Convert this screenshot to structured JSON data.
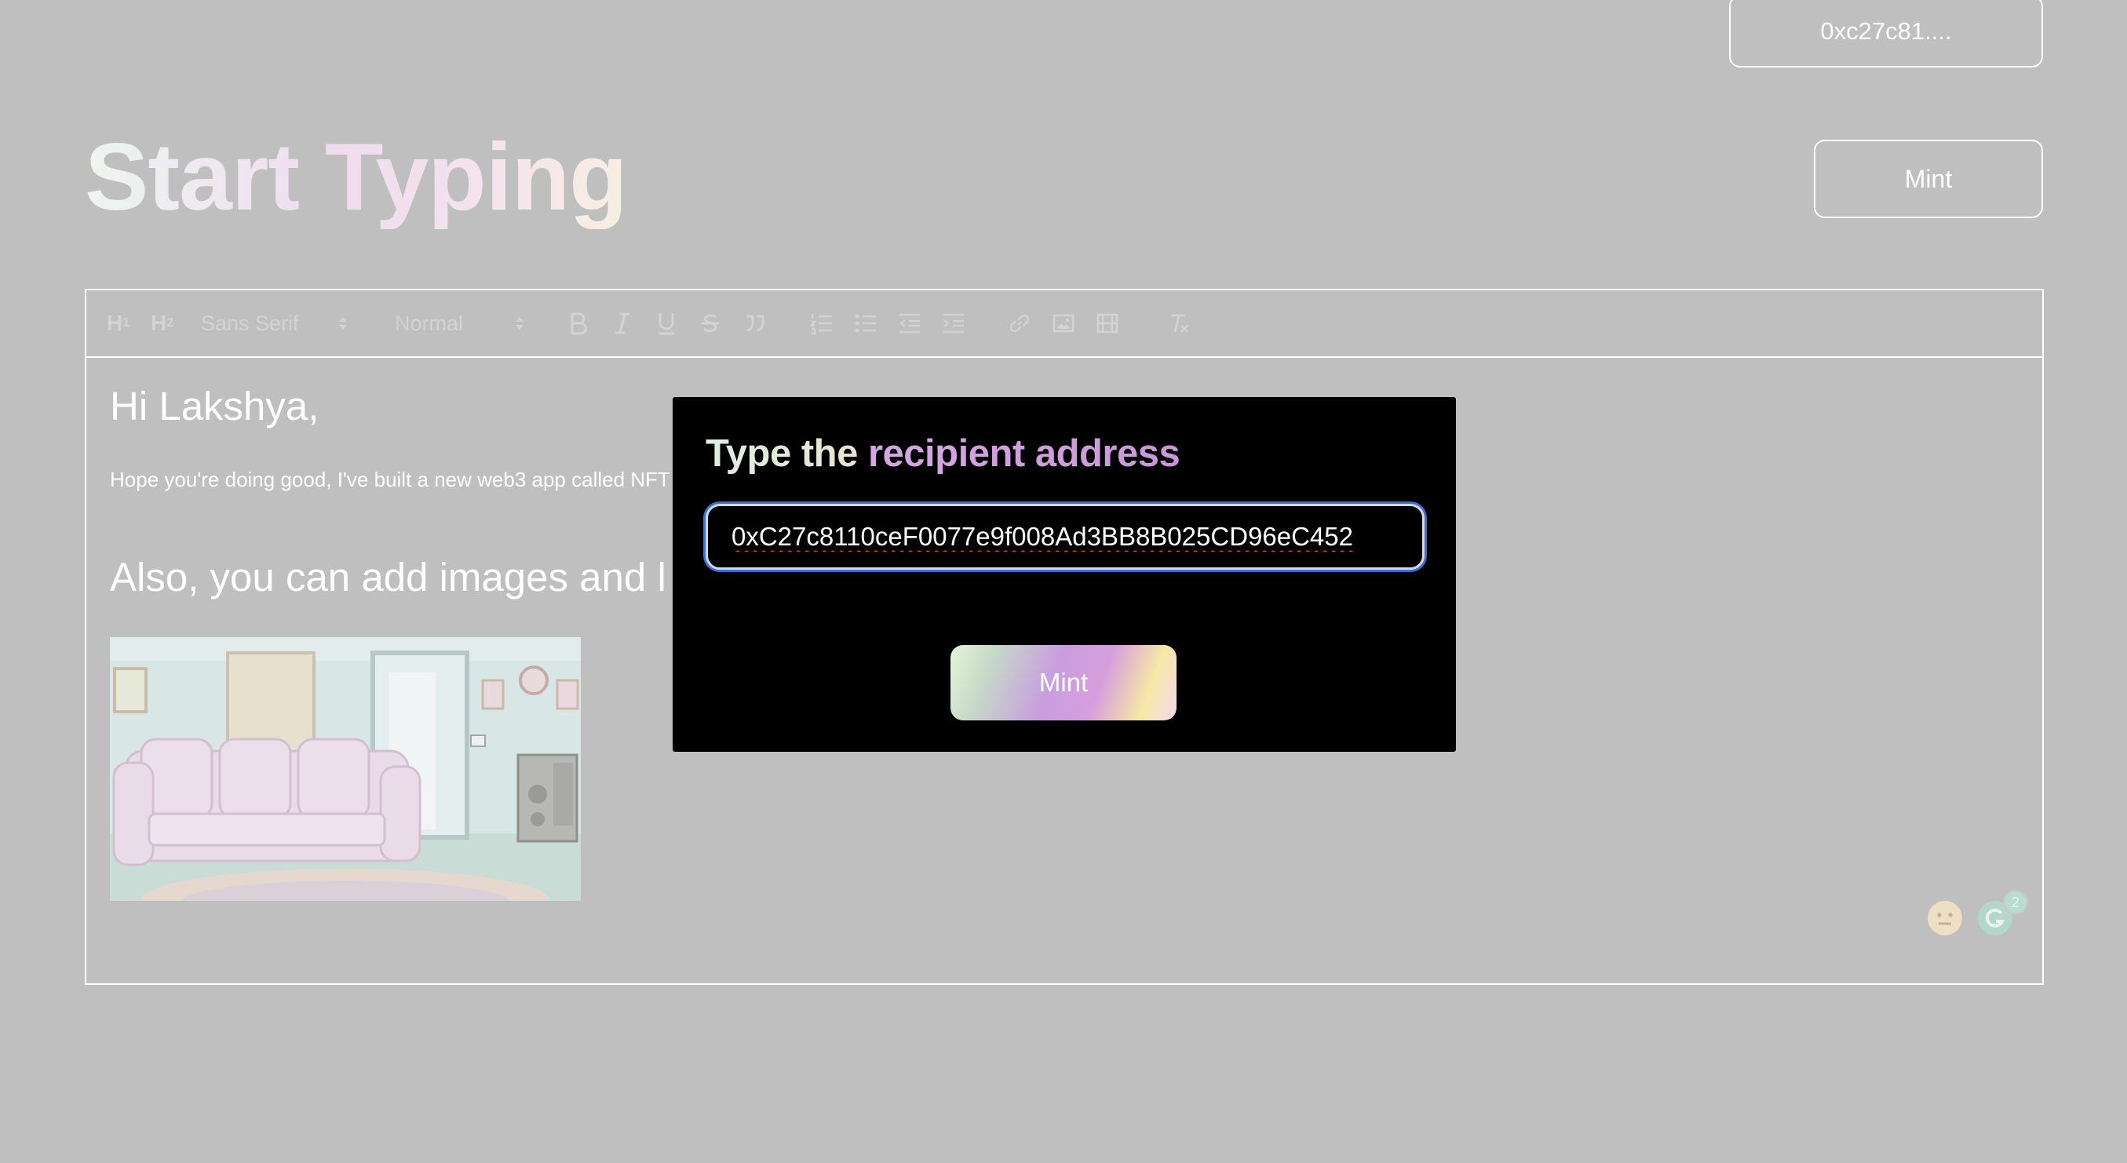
{
  "header": {
    "wallet_label": "0xc27c81....",
    "mint_label": "Mint",
    "title": "Start Typing"
  },
  "toolbar": {
    "heading1": "H",
    "heading1_sub": "1",
    "heading2": "H",
    "heading2_sub": "2",
    "font_select": "Sans Serif",
    "size_select": "Normal",
    "icons": [
      "bold-icon",
      "italic-icon",
      "underline-icon",
      "strike-icon",
      "quote-icon",
      "ordered-list-icon",
      "bullet-list-icon",
      "outdent-icon",
      "indent-icon",
      "link-icon",
      "image-icon",
      "video-icon",
      "clear-format-icon"
    ]
  },
  "editor": {
    "greeting": "Hi Lakshya,",
    "paragraph": "Hope you're doing good, I've built a new web3 app called NFT",
    "subheading": "Also, you can add images and l",
    "grammar_badge_count": "2"
  },
  "modal": {
    "title_lead": "Type the ",
    "title_accent": "recipient address",
    "address_value": "0xC27c8110ceF0077e9f008Ad3BB8B025CD96eC452",
    "mint_label": "Mint"
  }
}
